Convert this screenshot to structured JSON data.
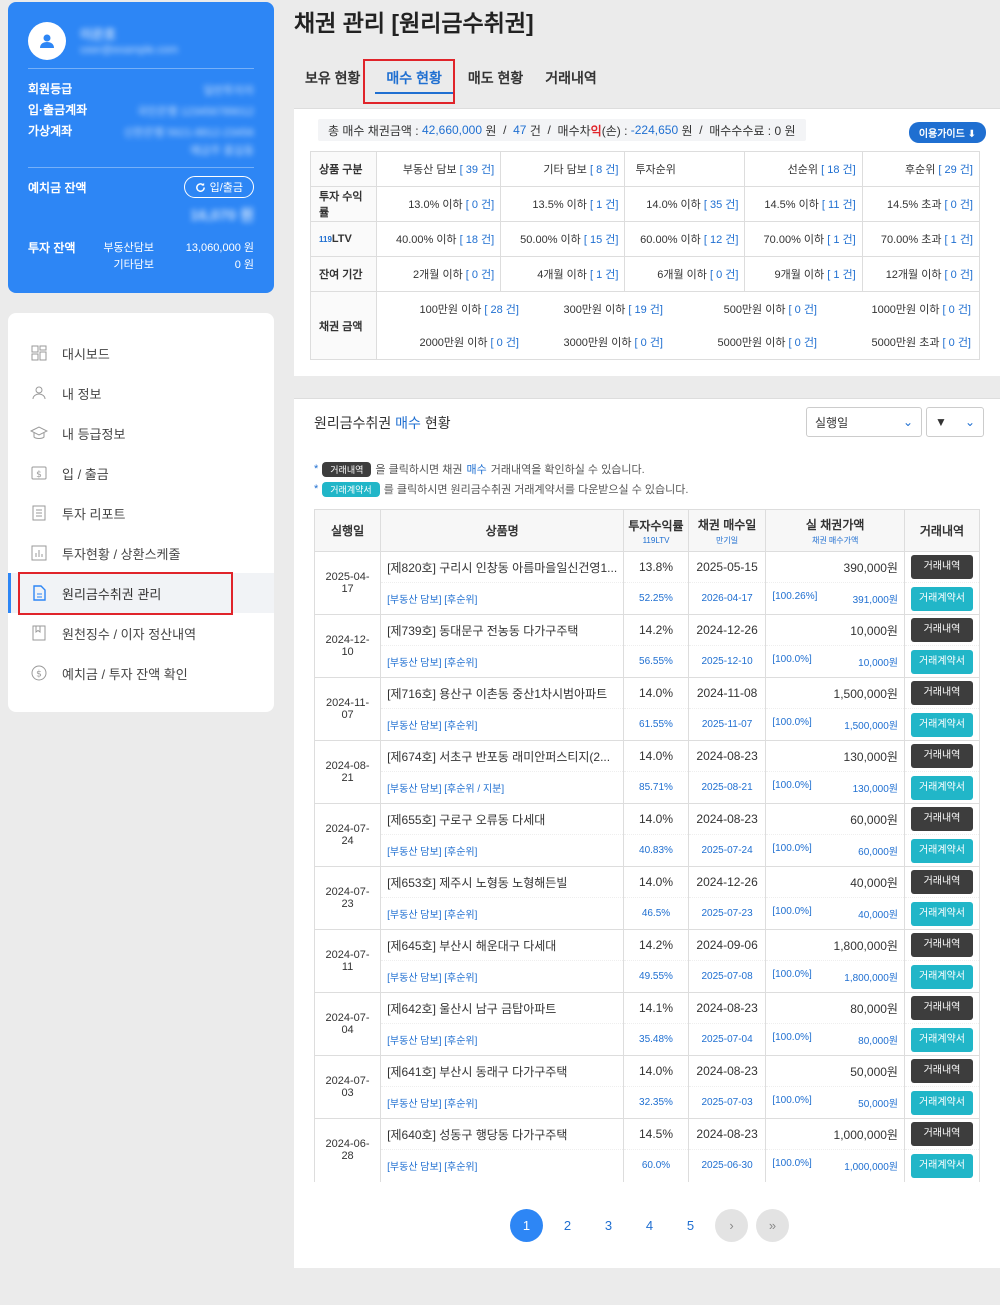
{
  "page_title": "채권 관리 [원리금수취권]",
  "user": {
    "name": "이은호",
    "email": "user@example.com",
    "rows": [
      {
        "label": "회원등급",
        "value": "일반투자자"
      },
      {
        "label": "입·출금계좌",
        "value": "국민은행 123456789012"
      },
      {
        "label": "가상계좌",
        "value": "신한은행 5621-8812-23456"
      }
    ],
    "virtual_extra": "예금주 홍길동",
    "deposit_label": "예치금 잔액",
    "deposit_button": "입/출금",
    "deposit_value": "16,070 원",
    "invest_label": "투자 잔액",
    "invest_rows": [
      {
        "label": "부동산담보",
        "value": "13,060,000 원"
      },
      {
        "label": "기타담보",
        "value": "0 원"
      }
    ]
  },
  "nav": {
    "items": [
      {
        "label": "대시보드"
      },
      {
        "label": "내 정보"
      },
      {
        "label": "내 등급정보"
      },
      {
        "label": "입 / 출금"
      },
      {
        "label": "투자 리포트"
      },
      {
        "label": "투자현황 / 상환스케줄"
      },
      {
        "label": "원리금수취권 관리"
      },
      {
        "label": "원천징수 / 이자 정산내역"
      },
      {
        "label": "예치금 / 투자 잔액 확인"
      }
    ]
  },
  "tabs": [
    "보유 현황",
    "매수 현황",
    "매도 현황",
    "거래내역"
  ],
  "summary": {
    "label1": "총 매수 채권금액 :",
    "amount": "42,660,000",
    "won": "원",
    "sep": "/",
    "count": "47",
    "gun": "건",
    "label2a": "매수차",
    "label2b": "익",
    "label2c": "(손) :",
    "diff": "-224,650",
    "label3": "매수수수료 :",
    "fee": "0 원",
    "guide": "이용가이드"
  },
  "filters": {
    "product": {
      "header": "상품 구분",
      "items": [
        {
          "label": "부동산 담보",
          "count": "[ 39 건]"
        },
        {
          "label": "기타 담보",
          "count": "[ 8 건]"
        }
      ],
      "rank_header": "투자순위",
      "ranks": [
        {
          "label": "선순위",
          "count": "[ 18 건]"
        },
        {
          "label": "후순위",
          "count": "[ 29 건]"
        }
      ]
    },
    "yield": {
      "header": "투자 수익률",
      "items": [
        {
          "label": "13.0% 이하",
          "count": "[ 0 건]"
        },
        {
          "label": "13.5% 이하",
          "count": "[ 1 건]"
        },
        {
          "label": "14.0% 이하",
          "count": "[ 35 건]"
        },
        {
          "label": "14.5% 이하",
          "count": "[ 11 건]"
        },
        {
          "label": "14.5% 초과",
          "count": "[ 0 건]"
        }
      ]
    },
    "ltv": {
      "header_num": "119",
      "header": "LTV",
      "items": [
        {
          "label": "40.00% 이하",
          "count": "[ 18 건]"
        },
        {
          "label": "50.00% 이하",
          "count": "[ 15 건]"
        },
        {
          "label": "60.00% 이하",
          "count": "[ 12 건]"
        },
        {
          "label": "70.00% 이하",
          "count": "[ 1 건]"
        },
        {
          "label": "70.00% 초과",
          "count": "[ 1 건]"
        }
      ]
    },
    "period": {
      "header": "잔여 기간",
      "items": [
        {
          "label": "2개월 이하",
          "count": "[ 0 건]"
        },
        {
          "label": "4개월 이하",
          "count": "[ 1 건]"
        },
        {
          "label": "6개월 이하",
          "count": "[ 0 건]"
        },
        {
          "label": "9개월 이하",
          "count": "[ 1 건]"
        },
        {
          "label": "12개월 이하",
          "count": "[ 0 건]"
        }
      ]
    },
    "amount": {
      "header": "채권 금액",
      "row1": [
        {
          "label": "100만원 이하",
          "count": "[ 28 건]"
        },
        {
          "label": "300만원 이하",
          "count": "[ 19 건]"
        },
        {
          "label": "500만원 이하",
          "count": "[ 0 건]"
        },
        {
          "label": "1000만원 이하",
          "count": "[ 0 건]"
        }
      ],
      "row2": [
        {
          "label": "2000만원 이하",
          "count": "[ 0 건]"
        },
        {
          "label": "3000만원 이하",
          "count": "[ 0 건]"
        },
        {
          "label": "5000만원 이하",
          "count": "[ 0 건]"
        },
        {
          "label": "5000만원 초과",
          "count": "[ 0 건]"
        }
      ]
    }
  },
  "list": {
    "title_a": "원리금수취권 ",
    "title_b": "매수",
    "title_c": " 현황",
    "sort_select": "실행일",
    "order_select": "▼",
    "note1_pill": "거래내역",
    "note1_a": "을 클릭하시면 채권",
    "note1_b": "매수",
    "note1_c": " 거래내역을 확인하실 수 있습니다.",
    "note2_pill": "거래계약서",
    "note2": "를 클릭하시면 원리금수취권 거래계약서를 다운받으실 수 있습니다.",
    "headers": {
      "date": "실행일",
      "product": "상품명",
      "yield": "투자수익률",
      "yield_sub": "119LTV",
      "buy": "채권 매수일",
      "buy_sub": "만기일",
      "value": "실 채권가액",
      "value_sub": "채권 매수가액",
      "history": "거래내역"
    },
    "btn_history": "거래내역",
    "btn_contract": "거래계약서",
    "rows": [
      {
        "date": "2025-04-17",
        "name": "[제820호] 구리시 인창동 아름마을일신건영1...",
        "tag": "[부동산 담보] [후순위]",
        "yield": "13.8%",
        "ltv": "52.25%",
        "buy": "2025-05-15",
        "due": "2026-04-17",
        "value": "390,000원",
        "pct": "[100.26%]",
        "price": "391,000원"
      },
      {
        "date": "2024-12-10",
        "name": "[제739호] 동대문구 전농동 다가구주택",
        "tag": "[부동산 담보] [후순위]",
        "yield": "14.2%",
        "ltv": "56.55%",
        "buy": "2024-12-26",
        "due": "2025-12-10",
        "value": "10,000원",
        "pct": "[100.0%]",
        "price": "10,000원"
      },
      {
        "date": "2024-11-07",
        "name": "[제716호] 용산구 이촌동 중산1차시범아파트",
        "tag": "[부동산 담보] [후순위]",
        "yield": "14.0%",
        "ltv": "61.55%",
        "buy": "2024-11-08",
        "due": "2025-11-07",
        "value": "1,500,000원",
        "pct": "[100.0%]",
        "price": "1,500,000원"
      },
      {
        "date": "2024-08-21",
        "name": "[제674호] 서초구 반포동 래미안퍼스티지(2...",
        "tag": "[부동산 담보] [후순위 / 지분]",
        "yield": "14.0%",
        "ltv": "85.71%",
        "buy": "2024-08-23",
        "due": "2025-08-21",
        "value": "130,000원",
        "pct": "[100.0%]",
        "price": "130,000원"
      },
      {
        "date": "2024-07-24",
        "name": "[제655호] 구로구 오류동 다세대",
        "tag": "[부동산 담보] [후순위]",
        "yield": "14.0%",
        "ltv": "40.83%",
        "buy": "2024-08-23",
        "due": "2025-07-24",
        "value": "60,000원",
        "pct": "[100.0%]",
        "price": "60,000원"
      },
      {
        "date": "2024-07-23",
        "name": "[제653호] 제주시 노형동 노형해든빌",
        "tag": "[부동산 담보] [후순위]",
        "yield": "14.0%",
        "ltv": "46.5%",
        "buy": "2024-12-26",
        "due": "2025-07-23",
        "value": "40,000원",
        "pct": "[100.0%]",
        "price": "40,000원"
      },
      {
        "date": "2024-07-11",
        "name": "[제645호] 부산시 해운대구 다세대",
        "tag": "[부동산 담보] [후순위]",
        "yield": "14.2%",
        "ltv": "49.55%",
        "buy": "2024-09-06",
        "due": "2025-07-08",
        "value": "1,800,000원",
        "pct": "[100.0%]",
        "price": "1,800,000원"
      },
      {
        "date": "2024-07-04",
        "name": "[제642호] 울산시 남구 금탑아파트",
        "tag": "[부동산 담보] [후순위]",
        "yield": "14.1%",
        "ltv": "35.48%",
        "buy": "2024-08-23",
        "due": "2025-07-04",
        "value": "80,000원",
        "pct": "[100.0%]",
        "price": "80,000원"
      },
      {
        "date": "2024-07-03",
        "name": "[제641호] 부산시 동래구 다가구주택",
        "tag": "[부동산 담보] [후순위]",
        "yield": "14.0%",
        "ltv": "32.35%",
        "buy": "2024-08-23",
        "due": "2025-07-03",
        "value": "50,000원",
        "pct": "[100.0%]",
        "price": "50,000원"
      },
      {
        "date": "2024-06-28",
        "name": "[제640호] 성동구 행당동 다가구주택",
        "tag": "[부동산 담보] [후순위]",
        "yield": "14.5%",
        "ltv": "60.0%",
        "buy": "2024-08-23",
        "due": "2025-06-30",
        "value": "1,000,000원",
        "pct": "[100.0%]",
        "price": "1,000,000원"
      }
    ]
  },
  "pagination": {
    "pages": [
      "1",
      "2",
      "3",
      "4",
      "5"
    ],
    "next": "›",
    "last": "»"
  }
}
